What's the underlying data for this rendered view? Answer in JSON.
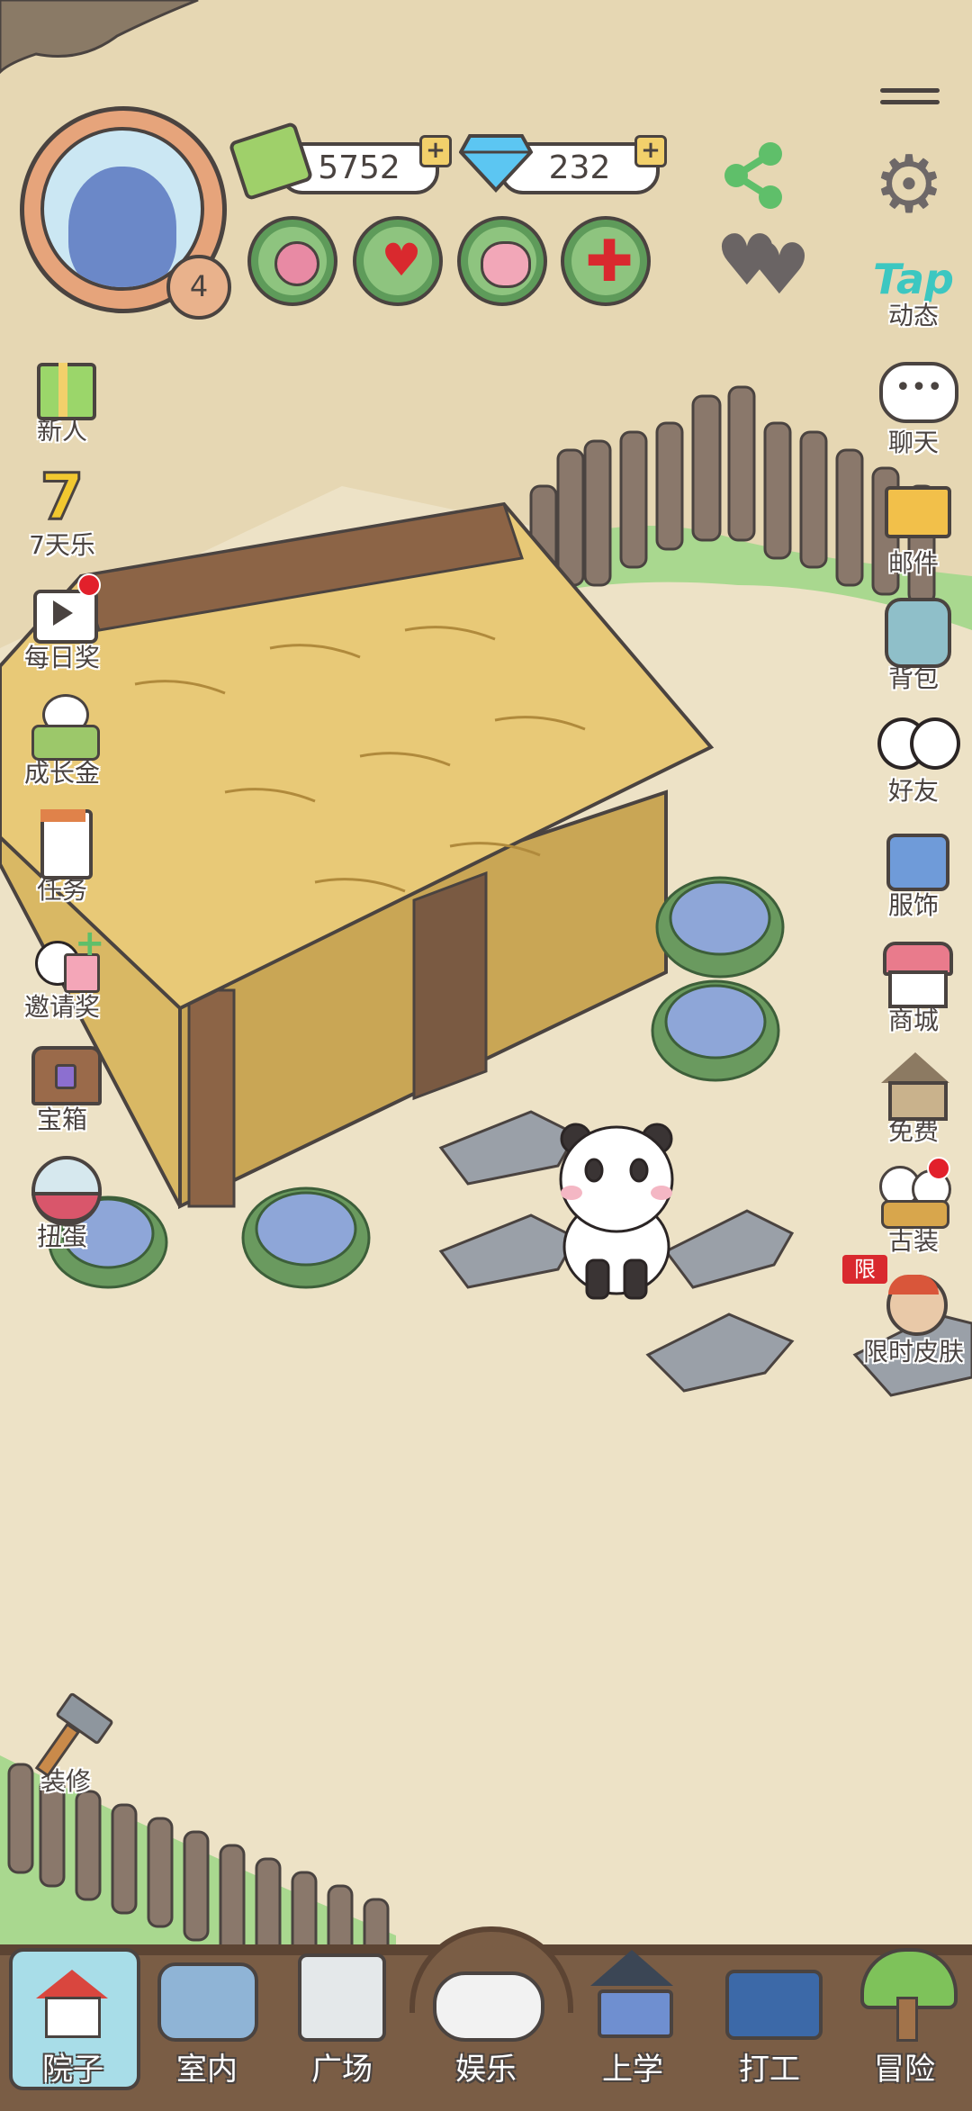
{
  "header": {
    "level": "4",
    "coins": "5752",
    "diamonds": "232",
    "plus": "+"
  },
  "right_menu": {
    "tap_logo": "Tap",
    "items": [
      {
        "label": "动态",
        "icon": "tap-icon"
      },
      {
        "label": "聊天",
        "icon": "chat-icon"
      },
      {
        "label": "邮件",
        "icon": "mail-icon"
      },
      {
        "label": "背包",
        "icon": "backpack-icon"
      },
      {
        "label": "好友",
        "icon": "friends-icon"
      },
      {
        "label": "服饰",
        "icon": "clothes-icon"
      },
      {
        "label": "商城",
        "icon": "shop-icon"
      },
      {
        "label": "免费",
        "icon": "free-house-icon"
      },
      {
        "label": "古装",
        "icon": "ancient-costume-icon"
      },
      {
        "label": "限时皮肤",
        "icon": "limited-skin-icon",
        "badge": "限"
      }
    ]
  },
  "left_menu": {
    "items": [
      {
        "label": "新人",
        "icon": "gift-icon"
      },
      {
        "label": "7天乐",
        "icon": "seven-days-icon",
        "digit": "7"
      },
      {
        "label": "每日奖",
        "icon": "video-reward-icon"
      },
      {
        "label": "成长金",
        "icon": "growth-fund-icon"
      },
      {
        "label": "任务",
        "icon": "task-icon"
      },
      {
        "label": "邀请奖",
        "icon": "invite-icon"
      },
      {
        "label": "宝箱",
        "icon": "chest-icon"
      },
      {
        "label": "扭蛋",
        "icon": "gacha-icon"
      }
    ],
    "decorate": "装修"
  },
  "bottom_nav": {
    "items": [
      {
        "label": "院子",
        "active": true
      },
      {
        "label": "室内"
      },
      {
        "label": "广场"
      },
      {
        "label": "娱乐"
      },
      {
        "label": "上学"
      },
      {
        "label": "打工"
      },
      {
        "label": "冒险"
      }
    ]
  },
  "colors": {
    "ground": "#ebdfc1",
    "sand_path": "#f0e6cf",
    "grass": "#a9d88f",
    "nav_bg": "#7a5d45",
    "nav_active": "#a8dde8",
    "outline": "#4a4340",
    "tap_teal": "#3cc7c1"
  }
}
